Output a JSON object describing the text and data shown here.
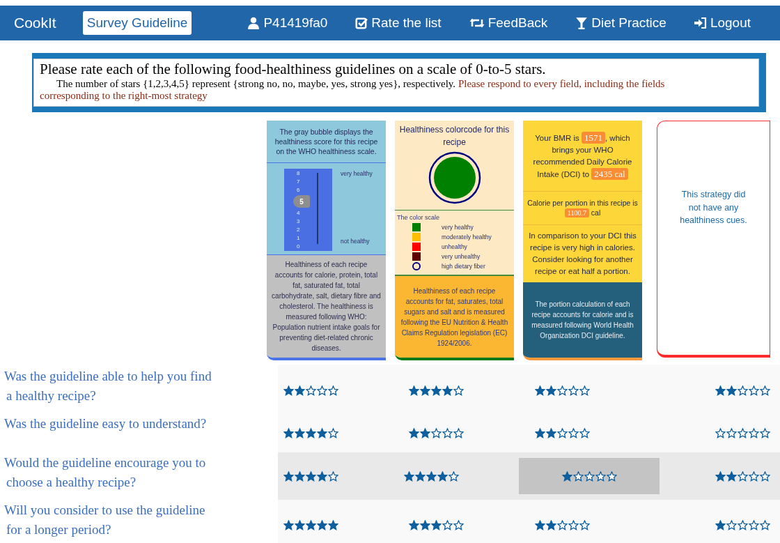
{
  "nav": {
    "brand": "CookIt",
    "items": [
      {
        "label": "Survey Guideline",
        "selected": true
      },
      {
        "label": "P41419fa0",
        "selected": false
      },
      {
        "label": "Rate the list",
        "selected": false
      },
      {
        "label": "FeedBack",
        "selected": false
      },
      {
        "label": "Diet Practice",
        "selected": false
      },
      {
        "label": "Logout",
        "selected": false
      }
    ]
  },
  "instructions": {
    "title": "Please rate each of the following food-healthiness guidelines on a scale of 0-to-5 stars.",
    "note": "The number of stars {1,2,3,4,5} represent {strong no, no, maybe, yes, strong yes}, respectively.",
    "warning": "Please respond to every field, including the fields",
    "warning_cont": "corresponding to the right-most strategy"
  },
  "cards": [
    {
      "kind": "scale",
      "intro": "The gray bubble displays the healthiness score for this recipe on the WHO healthiness scale.",
      "ticks_above": [
        "8",
        "7",
        "6"
      ],
      "bubble": "5",
      "ticks_below": [
        "4",
        "3",
        "2",
        "1",
        "0"
      ],
      "top_label": "very healthy",
      "bottom_label": "not healthy",
      "footer": "Healthiness of each recipe accounts for calorie, protein, total fat, saturated fat, total carbohydrate, salt, dietary fibre and cholesterol. The healthiness is measured following WHO: Population nutrient intake goals for preventing diet-related chronic diseases."
    },
    {
      "kind": "colorcode",
      "title": "Healthiness colorcode for this recipe",
      "code_circle": {
        "color": "#008000"
      },
      "legend_title": "The color scale",
      "legend": [
        {
          "label": "very healthy",
          "color": "#008000",
          "kind": "swatch"
        },
        {
          "label": "moderately healthy",
          "color": "#ffbf00",
          "kind": "swatch"
        },
        {
          "label": "unhealthy",
          "color": "#ff0000",
          "kind": "swatch"
        },
        {
          "label": "very unhealthy",
          "color": "#5c0000",
          "kind": "swatch"
        },
        {
          "label": "high dietary fiber",
          "color": "#000080",
          "kind": "ring"
        }
      ],
      "footer": "Healthiness of each recipe accounts for fat, saturates, total sugars and salt and is measured following the EU Nutrition & Health Claims Regulation legislation (EC) 1924/2006."
    },
    {
      "kind": "calorie",
      "bmr": [
        {
          "kind": "plain",
          "text": "Your BMR is "
        },
        {
          "kind": "badge",
          "text": "1571"
        },
        {
          "kind": "plain",
          "text": ", which brings your WHO recommended Daily Calorie Intake (DCI) to "
        },
        {
          "kind": "badge",
          "text": "2435 cal"
        }
      ],
      "portion": [
        {
          "kind": "plain",
          "text": "Calorie per portion in this recipe is "
        },
        {
          "kind": "badge",
          "text": "1100.7"
        },
        {
          "kind": "plain",
          "text": " cal"
        }
      ],
      "advice": "In comparison to your DCI this recipe is very high in calories. Consider looking for another recipe or eat half a portion.",
      "footer": "The portion calculation of each recipe accounts for calorie and is measured following World Health Organization DCI guideline."
    },
    {
      "kind": "none",
      "message": "This strategy did not have any healthiness cues."
    }
  ],
  "ratings": [
    {
      "question": [
        "Was the guideline able to help you find",
        "a healthy recipe?"
      ],
      "hovered": false,
      "cells": [
        {
          "stars": 2,
          "highlighted": false
        },
        {
          "stars": 4,
          "highlighted": false
        },
        {
          "stars": 2,
          "highlighted": false
        },
        {
          "stars": 2,
          "highlighted": false
        }
      ]
    },
    {
      "question": [
        "Was the guideline easy to understand?"
      ],
      "hovered": false,
      "cells": [
        {
          "stars": 4,
          "highlighted": false
        },
        {
          "stars": 2,
          "highlighted": false
        },
        {
          "stars": 2,
          "highlighted": false
        },
        {
          "stars": 0,
          "highlighted": false
        }
      ]
    },
    {
      "question": [
        "Would the guideline encourage you to",
        "choose a healthy recipe?"
      ],
      "hovered": true,
      "cells": [
        {
          "stars": 4,
          "highlighted": false
        },
        {
          "stars": 4,
          "highlighted": false
        },
        {
          "stars": 1,
          "highlighted": true
        },
        {
          "stars": 2,
          "highlighted": false
        }
      ]
    },
    {
      "question": [
        "Will you consider to use the guideline",
        "for a longer period?"
      ],
      "hovered": false,
      "cells": [
        {
          "stars": 5,
          "highlighted": false
        },
        {
          "stars": 3,
          "highlighted": false
        },
        {
          "stars": 2,
          "highlighted": false
        },
        {
          "stars": 1,
          "highlighted": false
        }
      ]
    }
  ]
}
